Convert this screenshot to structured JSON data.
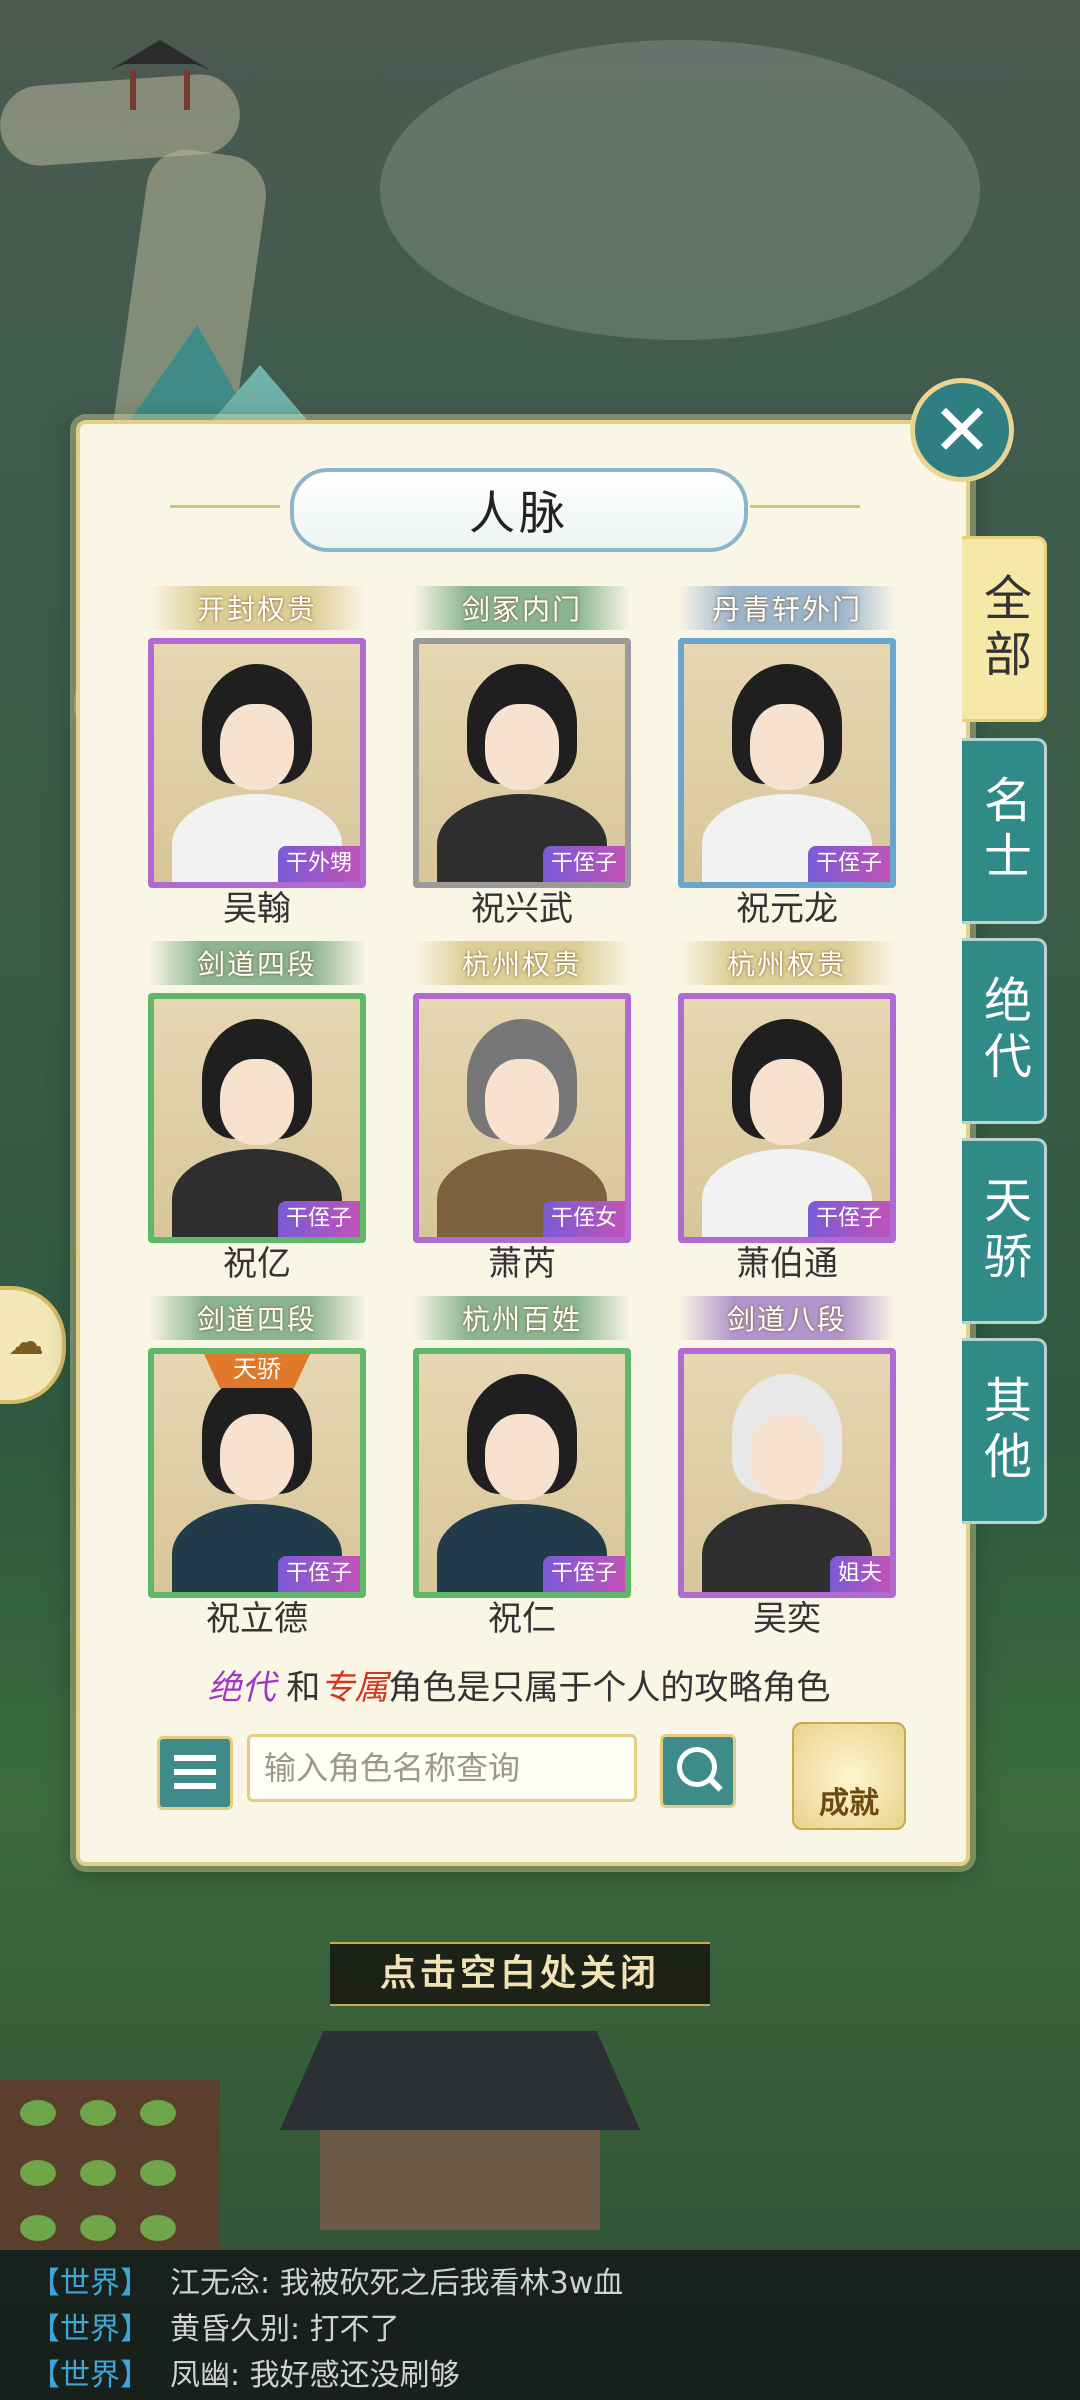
{
  "modal": {
    "title": "人脉",
    "tabs": [
      "全部",
      "名士",
      "绝代",
      "天骄",
      "其他"
    ],
    "active_tab": "全部",
    "characters": [
      {
        "tag": "开封权贵",
        "name": "吴翰",
        "relation": "干外甥"
      },
      {
        "tag": "剑冢内门",
        "name": "祝兴武",
        "relation": "干侄子"
      },
      {
        "tag": "丹青轩外门",
        "name": "祝元龙",
        "relation": "干侄子"
      },
      {
        "tag": "剑道四段",
        "name": "祝亿",
        "relation": "干侄子"
      },
      {
        "tag": "杭州权贵",
        "name": "萧芮",
        "relation": "干侄女"
      },
      {
        "tag": "杭州权贵",
        "name": "萧伯通",
        "relation": "干侄子"
      },
      {
        "tag": "剑道四段",
        "name": "祝立德",
        "relation": "干侄子",
        "badge": "天骄"
      },
      {
        "tag": "杭州百姓",
        "name": "祝仁",
        "relation": "干侄子"
      },
      {
        "tag": "剑道八段",
        "name": "吴奕",
        "relation": "姐夫"
      }
    ],
    "note": {
      "jd": "绝代",
      "and": "和",
      "zs": "专属",
      "rest": "角色是只属于个人的攻略角色"
    },
    "search": {
      "placeholder": "输入角色名称查询"
    },
    "achievement_label": "成就"
  },
  "close_hint": "点击空白处关闭",
  "chat": [
    {
      "channel": "【世界】",
      "text": "江无念: 我被砍死之后我看林3w血"
    },
    {
      "channel": "【世界】",
      "text": "黄昏久别: 打不了"
    },
    {
      "channel": "【世界】",
      "text": "凤幽: 我好感还没刷够"
    }
  ]
}
